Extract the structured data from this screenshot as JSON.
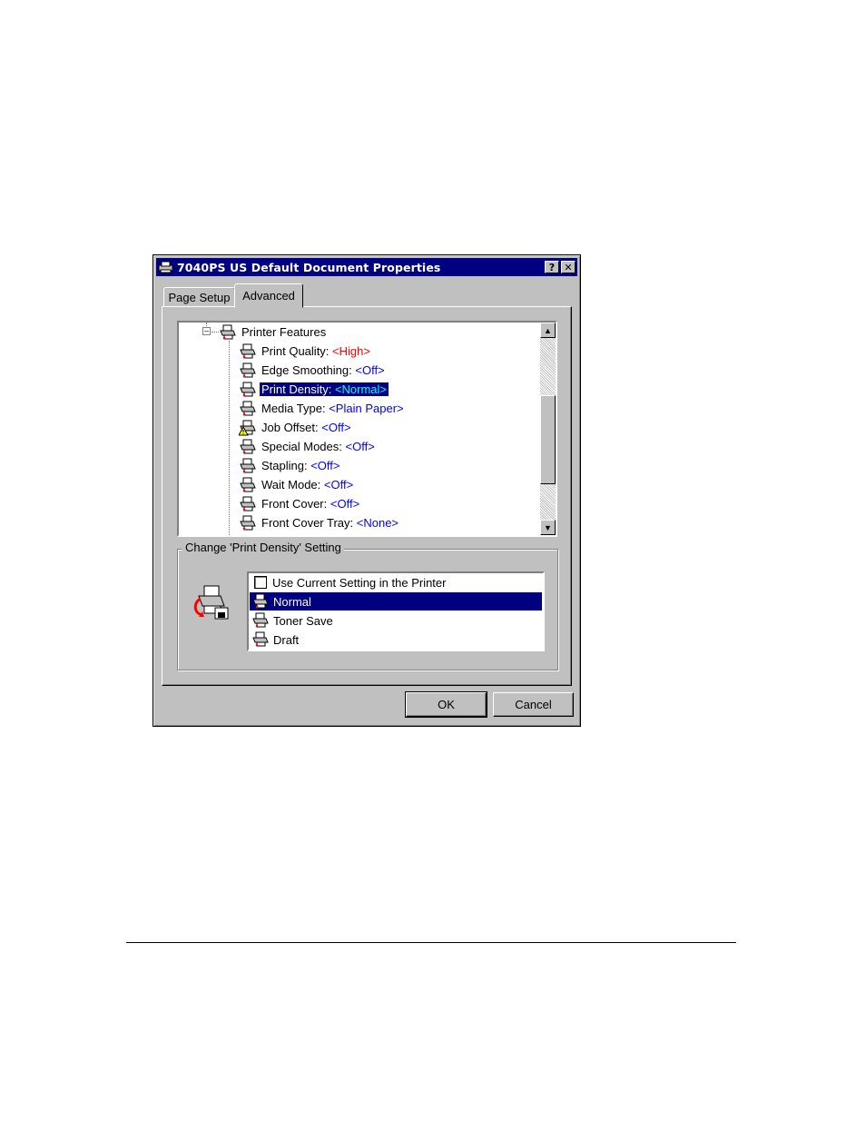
{
  "window": {
    "title": "7040PS US Default Document Properties",
    "help_button": "?",
    "close_button": "✕"
  },
  "tabs": [
    {
      "label": "Page Setup"
    },
    {
      "label": "Advanced"
    }
  ],
  "tree": {
    "root_label": "Printer Features",
    "items": [
      {
        "name": "Print Quality:",
        "value": "<High>",
        "icon": "printer-icon"
      },
      {
        "name": "Edge Smoothing:",
        "value": "<Off>",
        "icon": "printer-icon"
      },
      {
        "name": "Print Density:",
        "value": "<Normal>",
        "icon": "printer-icon"
      },
      {
        "name": "Media Type:",
        "value": "<Plain Paper>",
        "icon": "printer-icon"
      },
      {
        "name": "Job Offset:",
        "value": "<Off>",
        "icon": "warning-printer-icon"
      },
      {
        "name": "Special Modes:",
        "value": "<Off>",
        "icon": "printer-icon"
      },
      {
        "name": "Stapling:",
        "value": "<Off>",
        "icon": "printer-icon"
      },
      {
        "name": "Wait Mode:",
        "value": "<Off>",
        "icon": "printer-icon"
      },
      {
        "name": "Front Cover:",
        "value": "<Off>",
        "icon": "printer-icon"
      },
      {
        "name": "Front Cover Tray:",
        "value": "<None>",
        "icon": "printer-icon"
      }
    ]
  },
  "setting_group": {
    "title": "Change 'Print Density' Setting",
    "options": [
      {
        "label": "Use Current Setting in the Printer"
      },
      {
        "label": "Normal"
      },
      {
        "label": "Toner Save"
      },
      {
        "label": "Draft"
      }
    ]
  },
  "buttons": {
    "ok": "OK",
    "cancel": "Cancel"
  },
  "colors": {
    "titlebar": "#000080",
    "face": "#c0c0c0",
    "selection": "#000080",
    "value_changed": "#ff0000",
    "value_default": "#0000ff"
  }
}
